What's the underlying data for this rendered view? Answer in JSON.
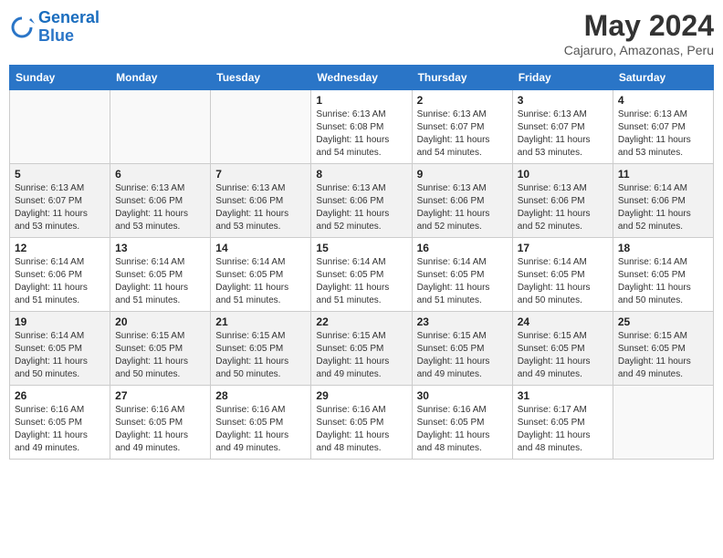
{
  "header": {
    "logo_line1": "General",
    "logo_line2": "Blue",
    "month_year": "May 2024",
    "location": "Cajaruro, Amazonas, Peru"
  },
  "weekdays": [
    "Sunday",
    "Monday",
    "Tuesday",
    "Wednesday",
    "Thursday",
    "Friday",
    "Saturday"
  ],
  "weeks": [
    [
      {
        "day": "",
        "info": ""
      },
      {
        "day": "",
        "info": ""
      },
      {
        "day": "",
        "info": ""
      },
      {
        "day": "1",
        "info": "Sunrise: 6:13 AM\nSunset: 6:08 PM\nDaylight: 11 hours\nand 54 minutes."
      },
      {
        "day": "2",
        "info": "Sunrise: 6:13 AM\nSunset: 6:07 PM\nDaylight: 11 hours\nand 54 minutes."
      },
      {
        "day": "3",
        "info": "Sunrise: 6:13 AM\nSunset: 6:07 PM\nDaylight: 11 hours\nand 53 minutes."
      },
      {
        "day": "4",
        "info": "Sunrise: 6:13 AM\nSunset: 6:07 PM\nDaylight: 11 hours\nand 53 minutes."
      }
    ],
    [
      {
        "day": "5",
        "info": "Sunrise: 6:13 AM\nSunset: 6:07 PM\nDaylight: 11 hours\nand 53 minutes."
      },
      {
        "day": "6",
        "info": "Sunrise: 6:13 AM\nSunset: 6:06 PM\nDaylight: 11 hours\nand 53 minutes."
      },
      {
        "day": "7",
        "info": "Sunrise: 6:13 AM\nSunset: 6:06 PM\nDaylight: 11 hours\nand 53 minutes."
      },
      {
        "day": "8",
        "info": "Sunrise: 6:13 AM\nSunset: 6:06 PM\nDaylight: 11 hours\nand 52 minutes."
      },
      {
        "day": "9",
        "info": "Sunrise: 6:13 AM\nSunset: 6:06 PM\nDaylight: 11 hours\nand 52 minutes."
      },
      {
        "day": "10",
        "info": "Sunrise: 6:13 AM\nSunset: 6:06 PM\nDaylight: 11 hours\nand 52 minutes."
      },
      {
        "day": "11",
        "info": "Sunrise: 6:14 AM\nSunset: 6:06 PM\nDaylight: 11 hours\nand 52 minutes."
      }
    ],
    [
      {
        "day": "12",
        "info": "Sunrise: 6:14 AM\nSunset: 6:06 PM\nDaylight: 11 hours\nand 51 minutes."
      },
      {
        "day": "13",
        "info": "Sunrise: 6:14 AM\nSunset: 6:05 PM\nDaylight: 11 hours\nand 51 minutes."
      },
      {
        "day": "14",
        "info": "Sunrise: 6:14 AM\nSunset: 6:05 PM\nDaylight: 11 hours\nand 51 minutes."
      },
      {
        "day": "15",
        "info": "Sunrise: 6:14 AM\nSunset: 6:05 PM\nDaylight: 11 hours\nand 51 minutes."
      },
      {
        "day": "16",
        "info": "Sunrise: 6:14 AM\nSunset: 6:05 PM\nDaylight: 11 hours\nand 51 minutes."
      },
      {
        "day": "17",
        "info": "Sunrise: 6:14 AM\nSunset: 6:05 PM\nDaylight: 11 hours\nand 50 minutes."
      },
      {
        "day": "18",
        "info": "Sunrise: 6:14 AM\nSunset: 6:05 PM\nDaylight: 11 hours\nand 50 minutes."
      }
    ],
    [
      {
        "day": "19",
        "info": "Sunrise: 6:14 AM\nSunset: 6:05 PM\nDaylight: 11 hours\nand 50 minutes."
      },
      {
        "day": "20",
        "info": "Sunrise: 6:15 AM\nSunset: 6:05 PM\nDaylight: 11 hours\nand 50 minutes."
      },
      {
        "day": "21",
        "info": "Sunrise: 6:15 AM\nSunset: 6:05 PM\nDaylight: 11 hours\nand 50 minutes."
      },
      {
        "day": "22",
        "info": "Sunrise: 6:15 AM\nSunset: 6:05 PM\nDaylight: 11 hours\nand 49 minutes."
      },
      {
        "day": "23",
        "info": "Sunrise: 6:15 AM\nSunset: 6:05 PM\nDaylight: 11 hours\nand 49 minutes."
      },
      {
        "day": "24",
        "info": "Sunrise: 6:15 AM\nSunset: 6:05 PM\nDaylight: 11 hours\nand 49 minutes."
      },
      {
        "day": "25",
        "info": "Sunrise: 6:15 AM\nSunset: 6:05 PM\nDaylight: 11 hours\nand 49 minutes."
      }
    ],
    [
      {
        "day": "26",
        "info": "Sunrise: 6:16 AM\nSunset: 6:05 PM\nDaylight: 11 hours\nand 49 minutes."
      },
      {
        "day": "27",
        "info": "Sunrise: 6:16 AM\nSunset: 6:05 PM\nDaylight: 11 hours\nand 49 minutes."
      },
      {
        "day": "28",
        "info": "Sunrise: 6:16 AM\nSunset: 6:05 PM\nDaylight: 11 hours\nand 49 minutes."
      },
      {
        "day": "29",
        "info": "Sunrise: 6:16 AM\nSunset: 6:05 PM\nDaylight: 11 hours\nand 48 minutes."
      },
      {
        "day": "30",
        "info": "Sunrise: 6:16 AM\nSunset: 6:05 PM\nDaylight: 11 hours\nand 48 minutes."
      },
      {
        "day": "31",
        "info": "Sunrise: 6:17 AM\nSunset: 6:05 PM\nDaylight: 11 hours\nand 48 minutes."
      },
      {
        "day": "",
        "info": ""
      }
    ]
  ]
}
